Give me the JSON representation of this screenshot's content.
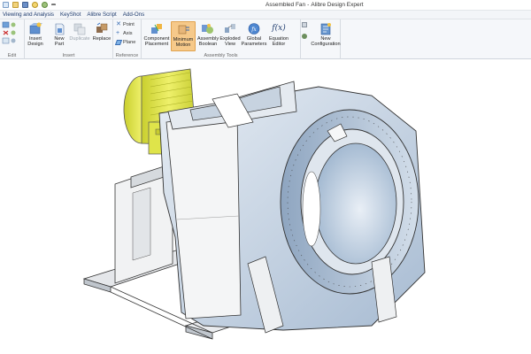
{
  "window": {
    "title": "Assembled Fan",
    "title_separator": "-",
    "app_name": "Alibre Design Expert"
  },
  "quick_access": [
    {
      "icon": "new-icon"
    },
    {
      "icon": "open-icon"
    },
    {
      "icon": "save-icon"
    },
    {
      "icon": "undo-icon"
    },
    {
      "icon": "redo-icon"
    },
    {
      "icon": "customize-icon"
    }
  ],
  "menu": {
    "items": [
      "Viewing and Analysis",
      "KeyShot",
      "Alibre Script",
      "Add-Ons"
    ]
  },
  "ribbon": {
    "groups": {
      "edit": "Edit",
      "insert": "Insert",
      "reference": "Reference",
      "assembly_tools": "Assembly Tools"
    },
    "tools": {
      "insert_design": "Insert\nDesign",
      "new_part": "New\nPart",
      "duplicate": "Duplicate",
      "replace": "Replace",
      "point": "Point",
      "axis": "Axis",
      "plane": "Plane",
      "component_placement": "Component\nPlacement",
      "minimum_motion": "Minimum\nMotion",
      "assembly_boolean": "Assembly\nBoolean",
      "exploded_view": "Exploded\nView",
      "global_parameters": "Global\nParameters",
      "equation_editor": "Equation\nEditor",
      "new_configuration": "New\nConfiguration"
    },
    "equation_symbol": "f(x)"
  },
  "colors": {
    "motor": "#dfe44a",
    "housing": "#b9c9dc",
    "sheet": "#f2f3f4",
    "accent_orange": "#f6c98a",
    "menu_text": "#1f3c6e"
  },
  "model": {
    "name": "Assembled Fan",
    "parts": [
      "motor",
      "motor-base",
      "fan-housing",
      "inlet-ring",
      "frame"
    ]
  }
}
